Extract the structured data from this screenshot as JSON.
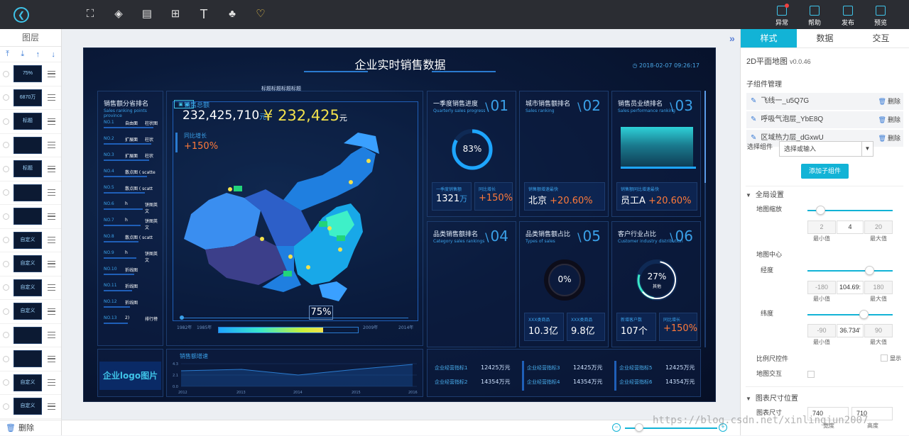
{
  "toolbar": {
    "tools": [
      "chart-tool-icon",
      "map-tool-icon",
      "media-tool-icon",
      "component-tool-icon",
      "text-tool-icon",
      "material-tool-icon",
      "favorite-icon"
    ],
    "right": [
      {
        "icon": "alert-icon",
        "label": "异常"
      },
      {
        "icon": "help-icon",
        "label": "帮助"
      },
      {
        "icon": "publish-icon",
        "label": "发布"
      },
      {
        "icon": "preview-icon",
        "label": "预览"
      }
    ]
  },
  "layers": {
    "title": "图层",
    "delete_label": "删除",
    "items": [
      "75%",
      "6870万",
      "标题",
      "",
      "标题",
      "",
      "",
      "自定义",
      "自定义",
      "自定义",
      "自定义",
      "",
      "",
      "自定义",
      "自定义"
    ]
  },
  "screen": {
    "title": "企业实时销售数据",
    "date": "2018-02-07 09:26:17",
    "title_label": "标题标题标题标题",
    "left_panel": {
      "title": "销售额分省排名",
      "sub": "Sales ranking points province",
      "rows": [
        {
          "no": "NO.1",
          "name": "自由面",
          "tag": "柱状图"
        },
        {
          "no": "NO.2",
          "name": "扩展面",
          "tag": "柱状"
        },
        {
          "no": "NO.3",
          "name": "扩展面",
          "tag": "柱状"
        },
        {
          "no": "NO.4",
          "name": "散点图 ( scatte",
          "tag": ""
        },
        {
          "no": "NO.5",
          "name": "散点图 ( scatt",
          "tag": ""
        },
        {
          "no": "NO.6",
          "name": "h",
          "tag": "饼图英文"
        },
        {
          "no": "NO.7",
          "name": "h",
          "tag": "饼图英文"
        },
        {
          "no": "NO.8",
          "name": "散点图 ( scatt",
          "tag": ""
        },
        {
          "no": "NO.9",
          "name": "h",
          "tag": "饼图英文"
        },
        {
          "no": "NO.10",
          "name": "折线图",
          "tag": ""
        },
        {
          "no": "NO.11",
          "name": "折线图",
          "tag": ""
        },
        {
          "no": "NO.12",
          "name": "折线图",
          "tag": ""
        },
        {
          "no": "NO.13",
          "name": "2)",
          "tag": "排行榜"
        }
      ]
    },
    "map": {
      "sales_total_label": "销售总额",
      "sales_total": "232,425,710",
      "unit_yuan": "元",
      "yuan_sign": "¥",
      "big_value": "232,425",
      "growth_label": "同比增长",
      "growth_value": "+150%",
      "progress": "75%",
      "year_start": "1982年",
      "year_mid": "1985年",
      "year_late": "2009年",
      "year_end": "2014年"
    },
    "cards": [
      {
        "num": "01",
        "title": "一季度销售进度",
        "sub": "Quarterly sales progress",
        "ring": "83%",
        "s1_label": "一季度销售额",
        "s1_value": "1321",
        "s1_unit": "万",
        "s2_label": "同比增长",
        "s2_value": "+150%"
      },
      {
        "num": "02",
        "title": "城市销售额排名",
        "sub": "Sales ranking",
        "s1_label": "销售额增速最快",
        "s1_value": "北京",
        "s1_delta": "+20.60%"
      },
      {
        "num": "03",
        "title": "销售员业绩排名",
        "sub": "Sales performance ranking",
        "s1_label": "销售额同比增速最快",
        "s1_value": "员工A",
        "s1_delta": "+20.60%"
      },
      {
        "num": "04",
        "title": "品类销售额排名",
        "sub": "Category sales rankings"
      },
      {
        "num": "05",
        "title": "品类销售额占比",
        "sub": "Types of sales",
        "ring": "0%",
        "s1_label": "XXX类商品",
        "s1_value": "10.3亿",
        "s2_label": "XXX类商品",
        "s2_value": "9.8亿"
      },
      {
        "num": "06",
        "title": "客户行业占比",
        "sub": "Customer industry distribution",
        "ring": "27%",
        "ring_sub": "其他",
        "s1_label": "新增客户数",
        "s1_value": "107个",
        "s2_label": "同比增长",
        "s2_value": "+150%"
      }
    ],
    "logo_text": "企业logo图片",
    "trend": {
      "title": "销售额增速",
      "yticks": [
        "4.3",
        "2.1",
        "0.0"
      ],
      "xticks": [
        "2012",
        "2013",
        "2014",
        "2015",
        "2016"
      ]
    },
    "kpis": [
      {
        "label": "企业经营指标1",
        "value": "12425万元"
      },
      {
        "label": "企业经营指标2",
        "value": "14354万元"
      },
      {
        "label": "企业经营指标3",
        "value": "12425万元"
      },
      {
        "label": "企业经营指标4",
        "value": "14354万元"
      },
      {
        "label": "企业经营指标5",
        "value": "12425万元"
      },
      {
        "label": "企业经营指标6",
        "value": "14354万元"
      }
    ]
  },
  "right_panel": {
    "tabs": [
      "样式",
      "数据",
      "交互"
    ],
    "component": "2D平面地图",
    "version": "v0.0.46",
    "sub_manage": "子组件管理",
    "sub_items": [
      "飞线一_u5Q7G",
      "呼吸气泡层_YbE8Q",
      "区域热力层_dGxwU"
    ],
    "delete_label": "删除",
    "select_label": "选择组件",
    "select_placeholder": "选择或输入",
    "add_button": "添加子组件",
    "global": "全局设置",
    "zoom_label": "地图缩放",
    "zoom_min": "2",
    "zoom_val": "4",
    "zoom_max": "20",
    "min_cap": "最小值",
    "max_cap": "最大值",
    "center_label": "地图中心",
    "lng_label": "经度",
    "lng_min": "-180",
    "lng_val": "104.69:",
    "lng_max": "180",
    "lat_label": "纬度",
    "lat_min": "-90",
    "lat_val": "36.734'",
    "lat_max": "90",
    "scale_label": "比例尺控件",
    "scale_show": "显示",
    "interact_label": "地图交互",
    "size_group": "图表尺寸位置",
    "size_label": "图表尺寸",
    "width_val": "740",
    "height_val": "710",
    "width_cap": "宽度",
    "height_cap": "高度"
  },
  "watermark": "https://blog.csdn.net/xinlingjun2007"
}
